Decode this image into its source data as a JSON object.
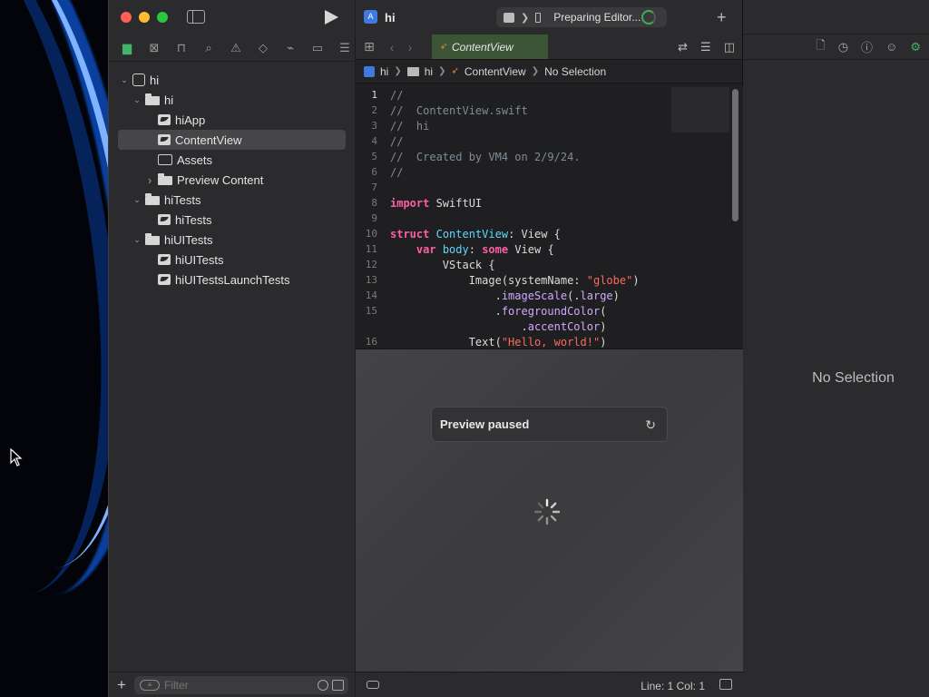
{
  "window": {
    "project_name": "hi",
    "scheme_status": "Preparing Editor...",
    "accent": "#43b36a"
  },
  "navigator": {
    "tools": [
      {
        "name": "project-navigator",
        "icon": "folder-icon"
      },
      {
        "name": "source-control",
        "icon": "x-square-icon"
      },
      {
        "name": "symbols",
        "icon": "hierarchy-icon"
      },
      {
        "name": "find",
        "icon": "search-icon"
      },
      {
        "name": "issues",
        "icon": "warning-icon"
      },
      {
        "name": "tests",
        "icon": "diamond-icon"
      },
      {
        "name": "debug",
        "icon": "spray-icon"
      },
      {
        "name": "breakpoints",
        "icon": "tag-icon"
      },
      {
        "name": "reports",
        "icon": "list-icon"
      }
    ],
    "tree": [
      {
        "label": "hi",
        "level": 0,
        "kind": "app",
        "expanded": true
      },
      {
        "label": "hi",
        "level": 1,
        "kind": "folder",
        "expanded": true
      },
      {
        "label": "hiApp",
        "level": 2,
        "kind": "swift"
      },
      {
        "label": "ContentView",
        "level": 2,
        "kind": "swift",
        "selected": true
      },
      {
        "label": "Assets",
        "level": 2,
        "kind": "assets"
      },
      {
        "label": "Preview Content",
        "level": 2,
        "kind": "folder",
        "expanded": false
      },
      {
        "label": "hiTests",
        "level": 1,
        "kind": "folder",
        "expanded": true
      },
      {
        "label": "hiTests",
        "level": 2,
        "kind": "swift"
      },
      {
        "label": "hiUITests",
        "level": 1,
        "kind": "folder",
        "expanded": true
      },
      {
        "label": "hiUITests",
        "level": 2,
        "kind": "swift"
      },
      {
        "label": "hiUITestsLaunchTests",
        "level": 2,
        "kind": "swift"
      }
    ],
    "filter_placeholder": "Filter"
  },
  "editor": {
    "tab_label": "ContentView",
    "breadcrumb": [
      "hi",
      "hi",
      "ContentView",
      "No Selection"
    ],
    "code_lines": [
      {
        "n": "1",
        "tokens": [
          [
            "cmt",
            "//"
          ]
        ]
      },
      {
        "n": "2",
        "tokens": [
          [
            "cmt",
            "//  ContentView.swift"
          ]
        ]
      },
      {
        "n": "3",
        "tokens": [
          [
            "cmt",
            "//  hi"
          ]
        ]
      },
      {
        "n": "4",
        "tokens": [
          [
            "cmt",
            "//"
          ]
        ]
      },
      {
        "n": "5",
        "tokens": [
          [
            "cmt",
            "//  Created by VM4 on 2/9/24."
          ]
        ]
      },
      {
        "n": "6",
        "tokens": [
          [
            "cmt",
            "//"
          ]
        ]
      },
      {
        "n": "7",
        "tokens": []
      },
      {
        "n": "8",
        "tokens": [
          [
            "kw",
            "import"
          ],
          [
            "txt",
            " SwiftUI"
          ]
        ]
      },
      {
        "n": "9",
        "tokens": []
      },
      {
        "n": "10",
        "tokens": [
          [
            "kw",
            "struct"
          ],
          [
            "txt",
            " "
          ],
          [
            "ty",
            "ContentView"
          ],
          [
            "txt",
            ": View {"
          ]
        ]
      },
      {
        "n": "11",
        "tokens": [
          [
            "txt",
            "    "
          ],
          [
            "kw",
            "var"
          ],
          [
            "txt",
            " "
          ],
          [
            "ty",
            "body"
          ],
          [
            "txt",
            ": "
          ],
          [
            "kw",
            "some"
          ],
          [
            "txt",
            " View {"
          ]
        ]
      },
      {
        "n": "12",
        "tokens": [
          [
            "txt",
            "        VStack {"
          ]
        ]
      },
      {
        "n": "13",
        "tokens": [
          [
            "txt",
            "            Image(systemName: "
          ],
          [
            "str",
            "\"globe\""
          ],
          [
            "txt",
            ")"
          ]
        ]
      },
      {
        "n": "14",
        "tokens": [
          [
            "txt",
            "                ."
          ],
          [
            "fn",
            "imageScale"
          ],
          [
            "txt",
            "(."
          ],
          [
            "fn",
            "large"
          ],
          [
            "txt",
            ")"
          ]
        ]
      },
      {
        "n": "15",
        "tokens": [
          [
            "txt",
            "                ."
          ],
          [
            "fn",
            "foregroundColor"
          ],
          [
            "txt",
            "("
          ]
        ]
      },
      {
        "n": "",
        "tokens": [
          [
            "txt",
            "                    ."
          ],
          [
            "fn",
            "accentColor"
          ],
          [
            "txt",
            ")"
          ]
        ]
      },
      {
        "n": "16",
        "tokens": [
          [
            "txt",
            "            Text("
          ],
          [
            "str",
            "\"Hello, world!\""
          ],
          [
            "txt",
            ")"
          ]
        ]
      }
    ],
    "preview_status": "Preview paused",
    "cursor_position": "Line: 1  Col: 1"
  },
  "inspector": {
    "placeholder": "No Selection",
    "tools": [
      "file-icon",
      "history-icon",
      "help-icon",
      "accessibility-icon",
      "attributes-icon"
    ]
  }
}
